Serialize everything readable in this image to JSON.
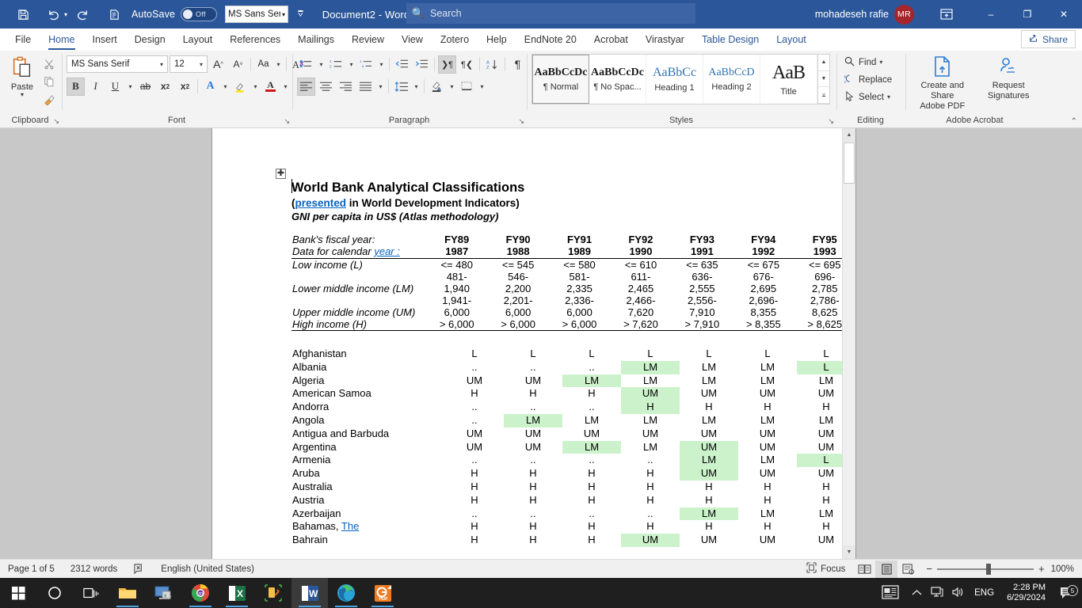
{
  "titlebar": {
    "save_icon": "save-icon",
    "undo_icon": "undo-icon",
    "redo_icon": "redo-icon",
    "print_preview_icon": "print-preview-icon",
    "autosave_label": "AutoSave",
    "autosave_state": "Off",
    "font_quick_value": "MS Sans Seri",
    "qat_more_icon": "customize-quick-access-icon",
    "document_title": "Document2  -  Word",
    "search_placeholder": "Search",
    "user_name": "mohadeseh rafie",
    "avatar_initials": "MR",
    "ribbon_display_icon": "ribbon-display-options-icon",
    "minimize": "–",
    "restore": "❐",
    "close": "✕"
  },
  "tabs": [
    {
      "label": "File",
      "state": "normal"
    },
    {
      "label": "Home",
      "state": "active"
    },
    {
      "label": "Insert",
      "state": "normal"
    },
    {
      "label": "Design",
      "state": "normal"
    },
    {
      "label": "Layout",
      "state": "normal"
    },
    {
      "label": "References",
      "state": "normal"
    },
    {
      "label": "Mailings",
      "state": "normal"
    },
    {
      "label": "Review",
      "state": "normal"
    },
    {
      "label": "View",
      "state": "normal"
    },
    {
      "label": "Zotero",
      "state": "normal"
    },
    {
      "label": "Help",
      "state": "normal"
    },
    {
      "label": "EndNote 20",
      "state": "normal"
    },
    {
      "label": "Acrobat",
      "state": "normal"
    },
    {
      "label": "Virastyar",
      "state": "normal"
    },
    {
      "label": "Table Design",
      "state": "contextual"
    },
    {
      "label": "Layout",
      "state": "contextual"
    }
  ],
  "share_button": "Share",
  "ribbon": {
    "clipboard": {
      "title": "Clipboard",
      "paste_label": "Paste",
      "cut_icon": "scissors-icon",
      "copy_icon": "copy-icon",
      "format_painter_icon": "format-painter-icon",
      "dialog_launcher": "↘"
    },
    "font": {
      "title": "Font",
      "font_name": "MS Sans Serif",
      "font_size": "12",
      "grow_font": "A",
      "shrink_font": "A",
      "change_case": "Aa",
      "clear_formatting": "A",
      "bold": "B",
      "italic": "I",
      "underline": "U",
      "strikethrough": "ab",
      "subscript": "x",
      "superscript": "x",
      "text_effects": "A",
      "highlight": "A",
      "font_color": "A",
      "dialog_launcher": "↘"
    },
    "paragraph": {
      "title": "Paragraph",
      "bullets_icon": "bullet-list-icon",
      "numbering_icon": "numbered-list-icon",
      "multilevel_icon": "multilevel-list-icon",
      "decrease_indent_icon": "decrease-indent-icon",
      "increase_indent_icon": "increase-indent-icon",
      "ltr_icon": "left-to-right-text-icon",
      "rtl_icon": "right-to-left-text-icon",
      "sort_icon": "sort-icon",
      "show_marks_icon": "show-formatting-marks-icon",
      "align_left_icon": "align-left-icon",
      "align_center_icon": "align-center-icon",
      "align_right_icon": "align-right-icon",
      "justify_icon": "justify-icon",
      "line_spacing_icon": "line-spacing-icon",
      "shading_icon": "shading-icon",
      "borders_icon": "borders-icon",
      "dialog_launcher": "↘"
    },
    "styles": {
      "title": "Styles",
      "dialog_launcher": "↘",
      "items": [
        {
          "preview": "AaBbCcDc",
          "name": "¶ Normal",
          "selected": true
        },
        {
          "preview": "AaBbCcDc",
          "name": "¶ No Spac...",
          "selected": false
        },
        {
          "preview": "AaBbCc",
          "name": "Heading 1",
          "selected": false
        },
        {
          "preview": "AaBbCcD",
          "name": "Heading 2",
          "selected": false
        },
        {
          "preview": "AaB",
          "name": "Title",
          "selected": false
        }
      ]
    },
    "editing": {
      "title": "Editing",
      "find": "Find",
      "replace": "Replace",
      "select": "Select"
    },
    "acrobat": {
      "title": "Adobe Acrobat",
      "create_share_l1": "Create and Share",
      "create_share_l2": "Adobe PDF",
      "request_l1": "Request",
      "request_l2": "Signatures"
    },
    "collapse_icon": "collapse-ribbon-icon"
  },
  "document": {
    "table_move_handle": "✚",
    "heading_line1": "World Bank Analytical Classifications",
    "heading_line2_pre": "(",
    "heading_line2_underlined": "presented",
    "heading_line2_post": " in World Development Indicators)",
    "heading_line3": "GNI per capita in US$ (Atlas methodology)",
    "classification": {
      "row_fiscal_year_label": "Bank's fiscal year:",
      "row_calendar_label_pre": "Data for calendar ",
      "row_calendar_label_underlined": "year :",
      "fiscal_years": [
        "FY89",
        "FY90",
        "FY91",
        "FY92",
        "FY93",
        "FY94",
        "FY95"
      ],
      "calendar_years": [
        "1987",
        "1988",
        "1989",
        "1990",
        "1991",
        "1992",
        "1993"
      ],
      "rows": [
        {
          "label": "Low income (L)",
          "values": [
            "<= 480",
            "<= 545",
            "<= 580",
            "<= 610",
            "<= 635",
            "<= 675",
            "<= 695"
          ]
        },
        {
          "label": "",
          "values": [
            "481-",
            "546-",
            "581-",
            "611-",
            "636-",
            "676-",
            "696-"
          ]
        },
        {
          "label": "Lower middle income (LM)",
          "values": [
            "1,940",
            "2,200",
            "2,335",
            "2,465",
            "2,555",
            "2,695",
            "2,785"
          ]
        },
        {
          "label": "",
          "values": [
            "1,941-",
            "2,201-",
            "2,336-",
            "2,466-",
            "2,556-",
            "2,696-",
            "2,786-"
          ]
        },
        {
          "label": "Upper middle income (UM)",
          "values": [
            "6,000",
            "6,000",
            "6,000",
            "7,620",
            "7,910",
            "8,355",
            "8,625"
          ]
        },
        {
          "label": "High income (H)",
          "values": [
            "> 6,000",
            "> 6,000",
            "> 6,000",
            "> 7,620",
            "> 7,910",
            "> 8,355",
            "> 8,625"
          ]
        }
      ]
    },
    "highlight_color": "#ccf2cc",
    "countries": [
      {
        "name": "Afghanistan",
        "values": [
          "L",
          "L",
          "L",
          "L",
          "L",
          "L",
          "L"
        ],
        "highlight": [
          false,
          false,
          false,
          false,
          false,
          false,
          false
        ]
      },
      {
        "name": "Albania",
        "values": [
          "..",
          "..",
          "..",
          "LM",
          "LM",
          "LM",
          "L"
        ],
        "highlight": [
          false,
          false,
          false,
          true,
          false,
          false,
          true
        ]
      },
      {
        "name": "Algeria",
        "values": [
          "UM",
          "UM",
          "LM",
          "LM",
          "LM",
          "LM",
          "LM"
        ],
        "highlight": [
          false,
          false,
          true,
          false,
          false,
          false,
          false
        ]
      },
      {
        "name": "American Samoa",
        "values": [
          "H",
          "H",
          "H",
          "UM",
          "UM",
          "UM",
          "UM"
        ],
        "highlight": [
          false,
          false,
          false,
          true,
          false,
          false,
          false
        ]
      },
      {
        "name": "Andorra",
        "values": [
          "..",
          "..",
          "..",
          "H",
          "H",
          "H",
          "H"
        ],
        "highlight": [
          false,
          false,
          false,
          true,
          false,
          false,
          false
        ]
      },
      {
        "name": "Angola",
        "values": [
          "..",
          "LM",
          "LM",
          "LM",
          "LM",
          "LM",
          "LM"
        ],
        "highlight": [
          false,
          true,
          false,
          false,
          false,
          false,
          false
        ]
      },
      {
        "name": "Antigua and Barbuda",
        "values": [
          "UM",
          "UM",
          "UM",
          "UM",
          "UM",
          "UM",
          "UM"
        ],
        "highlight": [
          false,
          false,
          false,
          false,
          false,
          false,
          false
        ]
      },
      {
        "name": "Argentina",
        "values": [
          "UM",
          "UM",
          "LM",
          "LM",
          "UM",
          "UM",
          "UM"
        ],
        "highlight": [
          false,
          false,
          true,
          false,
          true,
          false,
          false
        ]
      },
      {
        "name": "Armenia",
        "values": [
          "..",
          "..",
          "..",
          "..",
          "LM",
          "LM",
          "L"
        ],
        "highlight": [
          false,
          false,
          false,
          false,
          true,
          false,
          true
        ]
      },
      {
        "name": "Aruba",
        "values": [
          "H",
          "H",
          "H",
          "H",
          "UM",
          "UM",
          "UM"
        ],
        "highlight": [
          false,
          false,
          false,
          false,
          true,
          false,
          false
        ]
      },
      {
        "name": "Australia",
        "values": [
          "H",
          "H",
          "H",
          "H",
          "H",
          "H",
          "H"
        ],
        "highlight": [
          false,
          false,
          false,
          false,
          false,
          false,
          false
        ]
      },
      {
        "name": "Austria",
        "values": [
          "H",
          "H",
          "H",
          "H",
          "H",
          "H",
          "H"
        ],
        "highlight": [
          false,
          false,
          false,
          false,
          false,
          false,
          false
        ]
      },
      {
        "name": "Azerbaijan",
        "values": [
          "..",
          "..",
          "..",
          "..",
          "LM",
          "LM",
          "LM"
        ],
        "highlight": [
          false,
          false,
          false,
          false,
          true,
          false,
          false
        ]
      },
      {
        "name": "Bahamas, The",
        "name_underlined": "The",
        "values": [
          "H",
          "H",
          "H",
          "H",
          "H",
          "H",
          "H"
        ],
        "highlight": [
          false,
          false,
          false,
          false,
          false,
          false,
          false
        ]
      },
      {
        "name": "Bahrain",
        "values": [
          "H",
          "H",
          "H",
          "UM",
          "UM",
          "UM",
          "UM"
        ],
        "highlight": [
          false,
          false,
          false,
          true,
          false,
          false,
          false
        ]
      }
    ]
  },
  "statusbar": {
    "page": "Page 1 of 5",
    "words": "2312 words",
    "proofing_icon": "proofing-errors-icon",
    "language": "English (United States)",
    "focus": "Focus",
    "read_mode_icon": "read-mode-icon",
    "print_layout_icon": "print-layout-icon",
    "web_layout_icon": "web-layout-icon",
    "zoom_out": "−",
    "zoom_in": "+",
    "zoom_level": "100%"
  },
  "taskbar": {
    "items": [
      {
        "name": "start-button",
        "icon": "windows-logo-icon",
        "open": false
      },
      {
        "name": "search-button",
        "icon": "search-circle-icon",
        "open": false
      },
      {
        "name": "task-view-button",
        "icon": "task-view-icon",
        "open": false
      },
      {
        "name": "file-explorer",
        "icon": "folder-icon",
        "open": true
      },
      {
        "name": "remote-desktop",
        "icon": "remote-desktop-icon",
        "open": false
      },
      {
        "name": "chrome",
        "icon": "chrome-icon",
        "open": true
      },
      {
        "name": "excel",
        "icon": "excel-icon",
        "open": true
      },
      {
        "name": "app-tool",
        "icon": "toolbox-icon",
        "open": false
      },
      {
        "name": "word",
        "icon": "word-icon",
        "open": true,
        "active": true
      },
      {
        "name": "edge",
        "icon": "edge-icon",
        "open": true
      },
      {
        "name": "pdf-tool",
        "icon": "pdf-icon",
        "open": true
      }
    ],
    "tray": {
      "news_icon": "news-and-interests-icon",
      "show_hidden_icon": "show-hidden-icons-icon",
      "network_icon": "network-icon",
      "volume_icon": "volume-icon",
      "language": "ENG",
      "time": "2:28 PM",
      "date": "6/29/2024",
      "notification_icon": "notifications-icon",
      "notification_count": "5"
    }
  },
  "colors": {
    "word_blue": "#2b579a",
    "accent_blue": "#0563c1",
    "highlight_green": "#ccf2cc"
  }
}
